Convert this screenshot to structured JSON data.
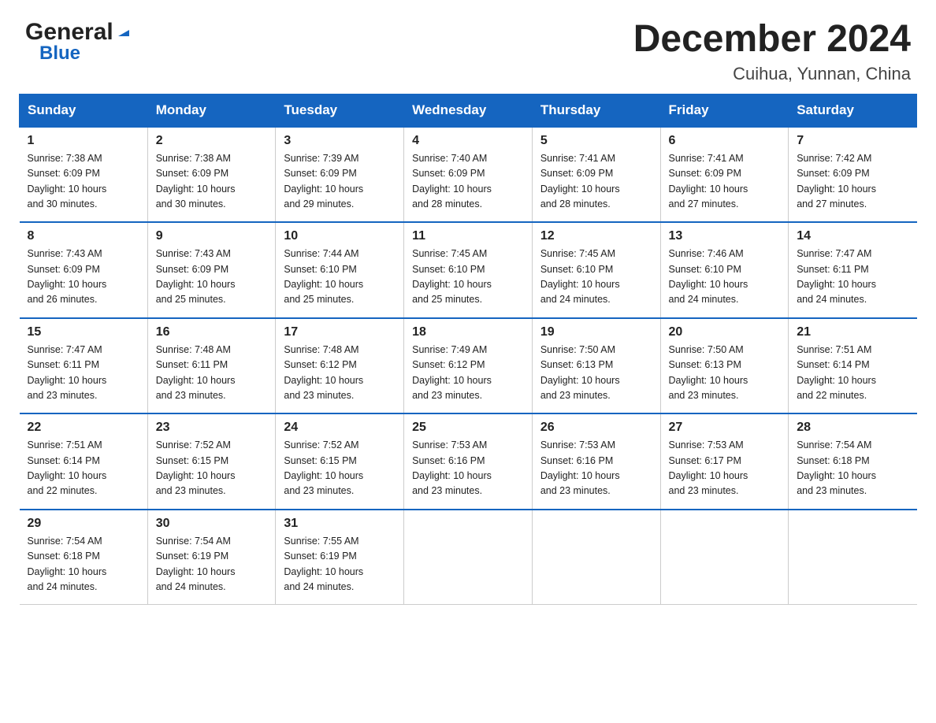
{
  "logo": {
    "general": "General",
    "blue": "Blue",
    "triangle": "▶"
  },
  "title": "December 2024",
  "subtitle": "Cuihua, Yunnan, China",
  "days_of_week": [
    "Sunday",
    "Monday",
    "Tuesday",
    "Wednesday",
    "Thursday",
    "Friday",
    "Saturday"
  ],
  "weeks": [
    [
      {
        "num": "1",
        "sunrise": "7:38 AM",
        "sunset": "6:09 PM",
        "daylight": "10 hours and 30 minutes."
      },
      {
        "num": "2",
        "sunrise": "7:38 AM",
        "sunset": "6:09 PM",
        "daylight": "10 hours and 30 minutes."
      },
      {
        "num": "3",
        "sunrise": "7:39 AM",
        "sunset": "6:09 PM",
        "daylight": "10 hours and 29 minutes."
      },
      {
        "num": "4",
        "sunrise": "7:40 AM",
        "sunset": "6:09 PM",
        "daylight": "10 hours and 28 minutes."
      },
      {
        "num": "5",
        "sunrise": "7:41 AM",
        "sunset": "6:09 PM",
        "daylight": "10 hours and 28 minutes."
      },
      {
        "num": "6",
        "sunrise": "7:41 AM",
        "sunset": "6:09 PM",
        "daylight": "10 hours and 27 minutes."
      },
      {
        "num": "7",
        "sunrise": "7:42 AM",
        "sunset": "6:09 PM",
        "daylight": "10 hours and 27 minutes."
      }
    ],
    [
      {
        "num": "8",
        "sunrise": "7:43 AM",
        "sunset": "6:09 PM",
        "daylight": "10 hours and 26 minutes."
      },
      {
        "num": "9",
        "sunrise": "7:43 AM",
        "sunset": "6:09 PM",
        "daylight": "10 hours and 25 minutes."
      },
      {
        "num": "10",
        "sunrise": "7:44 AM",
        "sunset": "6:10 PM",
        "daylight": "10 hours and 25 minutes."
      },
      {
        "num": "11",
        "sunrise": "7:45 AM",
        "sunset": "6:10 PM",
        "daylight": "10 hours and 25 minutes."
      },
      {
        "num": "12",
        "sunrise": "7:45 AM",
        "sunset": "6:10 PM",
        "daylight": "10 hours and 24 minutes."
      },
      {
        "num": "13",
        "sunrise": "7:46 AM",
        "sunset": "6:10 PM",
        "daylight": "10 hours and 24 minutes."
      },
      {
        "num": "14",
        "sunrise": "7:47 AM",
        "sunset": "6:11 PM",
        "daylight": "10 hours and 24 minutes."
      }
    ],
    [
      {
        "num": "15",
        "sunrise": "7:47 AM",
        "sunset": "6:11 PM",
        "daylight": "10 hours and 23 minutes."
      },
      {
        "num": "16",
        "sunrise": "7:48 AM",
        "sunset": "6:11 PM",
        "daylight": "10 hours and 23 minutes."
      },
      {
        "num": "17",
        "sunrise": "7:48 AM",
        "sunset": "6:12 PM",
        "daylight": "10 hours and 23 minutes."
      },
      {
        "num": "18",
        "sunrise": "7:49 AM",
        "sunset": "6:12 PM",
        "daylight": "10 hours and 23 minutes."
      },
      {
        "num": "19",
        "sunrise": "7:50 AM",
        "sunset": "6:13 PM",
        "daylight": "10 hours and 23 minutes."
      },
      {
        "num": "20",
        "sunrise": "7:50 AM",
        "sunset": "6:13 PM",
        "daylight": "10 hours and 23 minutes."
      },
      {
        "num": "21",
        "sunrise": "7:51 AM",
        "sunset": "6:14 PM",
        "daylight": "10 hours and 22 minutes."
      }
    ],
    [
      {
        "num": "22",
        "sunrise": "7:51 AM",
        "sunset": "6:14 PM",
        "daylight": "10 hours and 22 minutes."
      },
      {
        "num": "23",
        "sunrise": "7:52 AM",
        "sunset": "6:15 PM",
        "daylight": "10 hours and 23 minutes."
      },
      {
        "num": "24",
        "sunrise": "7:52 AM",
        "sunset": "6:15 PM",
        "daylight": "10 hours and 23 minutes."
      },
      {
        "num": "25",
        "sunrise": "7:53 AM",
        "sunset": "6:16 PM",
        "daylight": "10 hours and 23 minutes."
      },
      {
        "num": "26",
        "sunrise": "7:53 AM",
        "sunset": "6:16 PM",
        "daylight": "10 hours and 23 minutes."
      },
      {
        "num": "27",
        "sunrise": "7:53 AM",
        "sunset": "6:17 PM",
        "daylight": "10 hours and 23 minutes."
      },
      {
        "num": "28",
        "sunrise": "7:54 AM",
        "sunset": "6:18 PM",
        "daylight": "10 hours and 23 minutes."
      }
    ],
    [
      {
        "num": "29",
        "sunrise": "7:54 AM",
        "sunset": "6:18 PM",
        "daylight": "10 hours and 24 minutes."
      },
      {
        "num": "30",
        "sunrise": "7:54 AM",
        "sunset": "6:19 PM",
        "daylight": "10 hours and 24 minutes."
      },
      {
        "num": "31",
        "sunrise": "7:55 AM",
        "sunset": "6:19 PM",
        "daylight": "10 hours and 24 minutes."
      },
      null,
      null,
      null,
      null
    ]
  ],
  "labels": {
    "sunrise": "Sunrise:",
    "sunset": "Sunset:",
    "daylight": "Daylight:"
  }
}
